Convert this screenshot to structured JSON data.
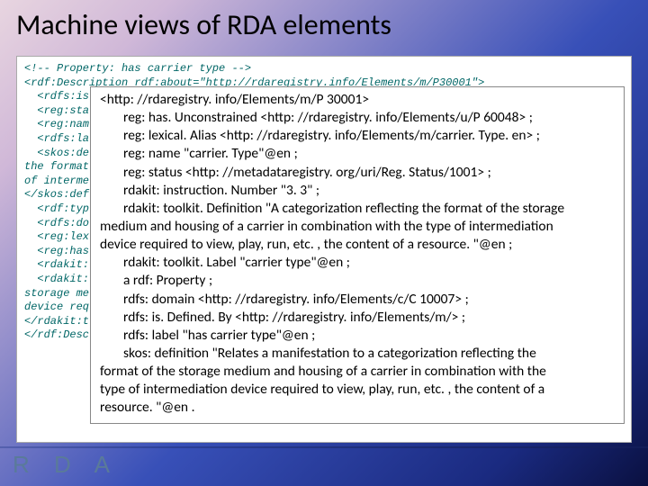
{
  "title": "Machine views of RDA elements",
  "bg_code": "<!-- Property: has carrier type -->\n<rdf:Description rdf:about=\"http://rdaregistry.info/Elements/m/P30001\">\n  <rdfs:is\n  <reg:sta\n  <reg:nam\n  <rdfs:la\n  <skos:de\nthe format\nof interme\n</skos:def\n  <rdf:typ\n  <rdfs:do\n  <reg:lex\n  <reg:has\n  <rdakit:\n  <rdakit:\nstorage me\ndevice req\n</rdakit:t\n</rdf:Desc",
  "overlay": {
    "l1": "<http: //rdaregistry. info/Elements/m/P 30001>",
    "l2": "reg: has. Unconstrained <http: //rdaregistry. info/Elements/u/P 60048> ;",
    "l3": "reg: lexical. Alias <http: //rdaregistry. info/Elements/m/carrier. Type. en> ;",
    "l4": "reg: name \"carrier. Type\"@en ;",
    "l5": "reg: status <http: //metadataregistry. org/uri/Reg. Status/1001> ;",
    "l6": "rdakit: instruction. Number \"3. 3\" ;",
    "l7": "rdakit: toolkit. Definition \"A categorization reflecting the format of the storage",
    "l8": "medium and housing of a carrier in combination with the type of intermediation",
    "l9": "device required to view, play, run, etc. , the content of a resource. \"@en ;",
    "l10": "rdakit: toolkit. Label \"carrier type\"@en ;",
    "l11": "a rdf: Property ;",
    "l12": "rdfs: domain <http: //rdaregistry. info/Elements/c/C 10007> ;",
    "l13": "rdfs: is. Defined. By <http: //rdaregistry. info/Elements/m/> ;",
    "l14": "rdfs: label \"has carrier type\"@en ;",
    "l15": "skos: definition \"Relates a manifestation to a categorization reflecting the",
    "l16": "format of the storage medium and housing of a carrier in combination with the",
    "l17": "type of intermediation device required to view, play, run, etc. , the content of a",
    "l18": "resource. \"@en ."
  },
  "logo": "R D A"
}
